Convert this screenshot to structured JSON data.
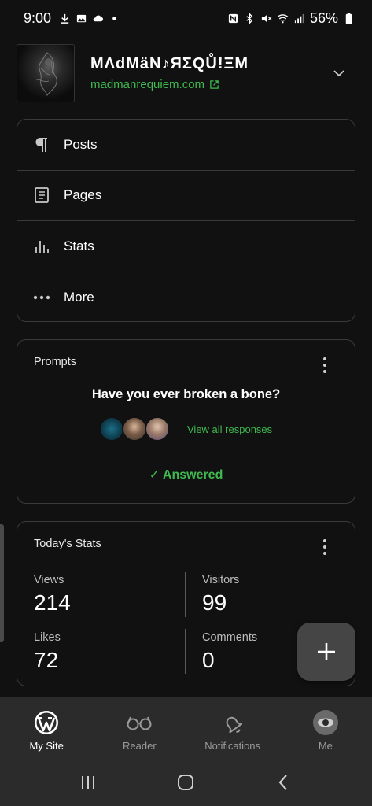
{
  "status_bar": {
    "time": "9:00",
    "battery": "56%",
    "left_icons": [
      "download-icon",
      "image-icon",
      "cloud-icon",
      "dot-icon"
    ],
    "right_icons": [
      "nfc-icon",
      "bluetooth-icon",
      "mute-icon",
      "wifi-icon",
      "signal-icon",
      "battery-icon"
    ]
  },
  "site": {
    "title": "MΛdMäN♪ЯΣQŮ!ΞM",
    "url": "madmanrequiem.com"
  },
  "menu": {
    "items": [
      {
        "label": "Posts",
        "icon": "paragraph-icon"
      },
      {
        "label": "Pages",
        "icon": "page-icon"
      },
      {
        "label": "Stats",
        "icon": "stats-icon"
      },
      {
        "label": "More",
        "icon": "more-icon"
      }
    ]
  },
  "prompts": {
    "title": "Prompts",
    "question": "Have you ever broken a bone?",
    "view_all": "View all responses",
    "answered": "✓ Answered"
  },
  "stats": {
    "title": "Today's Stats",
    "views_label": "Views",
    "views_value": "214",
    "visitors_label": "Visitors",
    "visitors_value": "99",
    "likes_label": "Likes",
    "likes_value": "72",
    "comments_label": "Comments",
    "comments_value": "0"
  },
  "tabs": [
    {
      "label": "My Site",
      "icon": "wordpress-icon",
      "active": true
    },
    {
      "label": "Reader",
      "icon": "glasses-icon",
      "active": false
    },
    {
      "label": "Notifications",
      "icon": "bell-icon",
      "active": false
    },
    {
      "label": "Me",
      "icon": "profile-avatar",
      "active": false
    }
  ],
  "colors": {
    "background": "#111111",
    "accent_green": "#3fb950",
    "card_border": "#3a3a3a",
    "tab_bar": "#2b2b2b"
  }
}
